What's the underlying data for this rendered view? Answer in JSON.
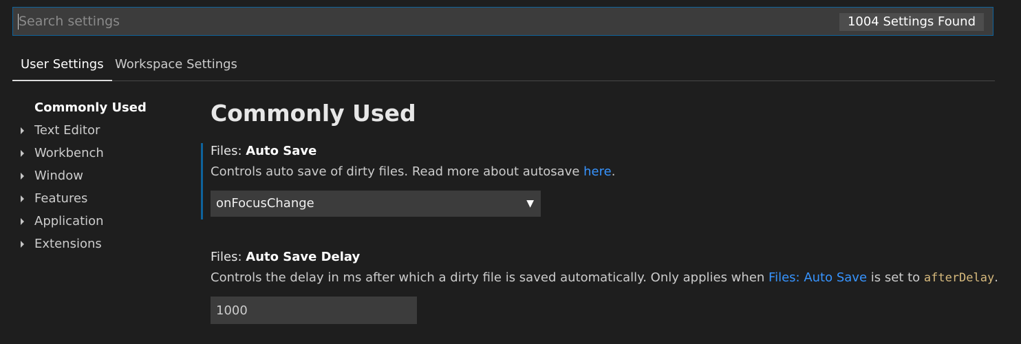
{
  "search": {
    "placeholder": "Search settings",
    "value": "",
    "result_count": "1004 Settings Found"
  },
  "tabs": [
    {
      "label": "User Settings",
      "active": true
    },
    {
      "label": "Workspace Settings",
      "active": false
    }
  ],
  "toc": {
    "items": [
      {
        "label": "Commonly Used",
        "selected": true,
        "expandable": false
      },
      {
        "label": "Text Editor",
        "selected": false,
        "expandable": true
      },
      {
        "label": "Workbench",
        "selected": false,
        "expandable": true
      },
      {
        "label": "Window",
        "selected": false,
        "expandable": true
      },
      {
        "label": "Features",
        "selected": false,
        "expandable": true
      },
      {
        "label": "Application",
        "selected": false,
        "expandable": true
      },
      {
        "label": "Extensions",
        "selected": false,
        "expandable": true
      }
    ]
  },
  "main": {
    "section_title": "Commonly Used",
    "settings": [
      {
        "category": "Files: ",
        "label": "Auto Save",
        "description_before": "Controls auto save of dirty files. Read more about autosave ",
        "description_link": "here",
        "description_after": ".",
        "control": "select",
        "value": "onFocusChange",
        "arrow": "▼"
      },
      {
        "category": "Files: ",
        "label": "Auto Save Delay",
        "description_before": "Controls the delay in ms after which a dirty file is saved automatically. Only applies when ",
        "description_link": "Files: Auto Save",
        "description_middle": " is set to ",
        "description_code": "afterDelay",
        "description_after": ".",
        "control": "number",
        "value": "1000"
      }
    ]
  },
  "colors": {
    "background": "#1e1e1e",
    "input_background": "#3c3c3c",
    "focus_border": "#0e639c",
    "link": "#3794ff",
    "code": "#d7ba7d"
  }
}
